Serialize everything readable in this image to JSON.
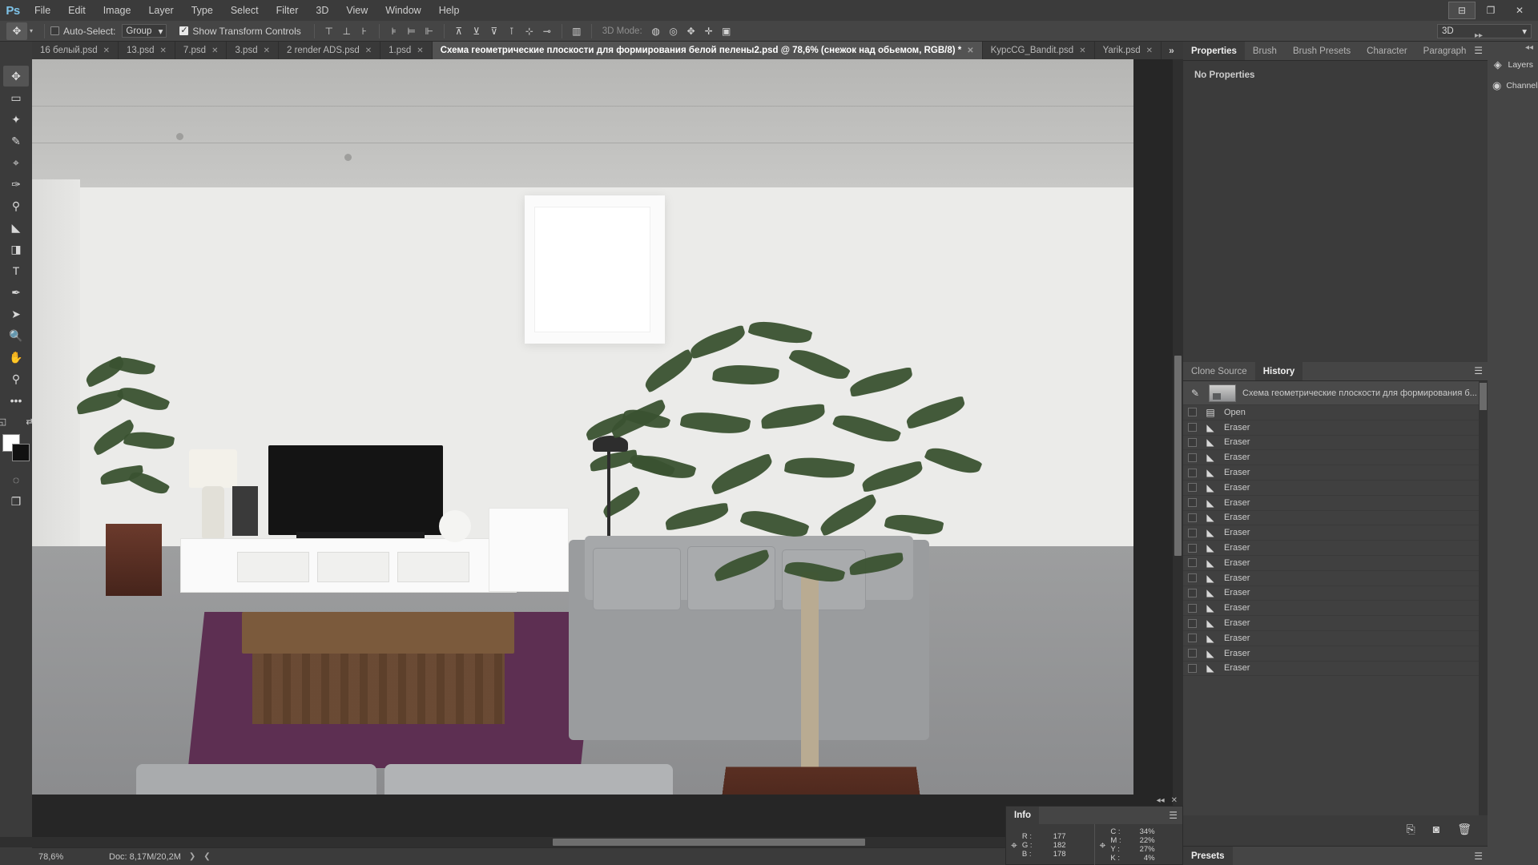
{
  "app": {
    "logo": "Ps",
    "workspace": "3D"
  },
  "menubar": {
    "items": [
      "File",
      "Edit",
      "Image",
      "Layer",
      "Type",
      "Select",
      "Filter",
      "3D",
      "View",
      "Window",
      "Help"
    ]
  },
  "window_controls": {
    "minimize": "⊟",
    "restore": "❐",
    "close": "✕"
  },
  "options_bar": {
    "tool_icon": "✥",
    "auto_select_label": "Auto-Select:",
    "auto_select_checked": false,
    "group_value": "Group",
    "show_transform_label": "Show Transform Controls",
    "show_transform_checked": true,
    "align_icons": [
      "⊤",
      "⊥",
      "⊦",
      "⊧",
      "⊨",
      "⊩"
    ],
    "distribute_icons": [
      "⊼",
      "⊻",
      "⊽",
      "⊺",
      "⊹",
      "⊸"
    ],
    "extra_icon": "▥",
    "mode_3d_label": "3D Mode:",
    "mode_3d_icons": [
      "◍",
      "◎",
      "✥",
      "✛",
      "▣"
    ]
  },
  "document_tabs": [
    {
      "label": "16 белый.psd",
      "active": false,
      "close": "✕"
    },
    {
      "label": "13.psd",
      "active": false,
      "close": "✕"
    },
    {
      "label": "7.psd",
      "active": false,
      "close": "✕"
    },
    {
      "label": "3.psd",
      "active": false,
      "close": "✕"
    },
    {
      "label": "2 render ADS.psd",
      "active": false,
      "close": "✕"
    },
    {
      "label": "1.psd",
      "active": false,
      "close": "✕"
    },
    {
      "label": "Схема геометрические плоскости для формирования белой пелены2.psd @ 78,6% (снежок над обьемом, RGB/8) *",
      "active": true,
      "close": "✕"
    },
    {
      "label": "KypcCG_Bandit.psd",
      "active": false,
      "close": "✕"
    },
    {
      "label": "Yarik.psd",
      "active": false,
      "close": "✕"
    }
  ],
  "tabs_overflow": "»",
  "toolbar": {
    "tools": [
      {
        "name": "move-tool",
        "glyph": "✥",
        "selected": true
      },
      {
        "name": "marquee-tool",
        "glyph": "▭",
        "selected": false
      },
      {
        "name": "lasso-tool",
        "glyph": "✦",
        "selected": false
      },
      {
        "name": "quick-selection-tool",
        "glyph": "✎",
        "selected": false
      },
      {
        "name": "eyedropper-tool",
        "glyph": "⌖",
        "selected": false
      },
      {
        "name": "brush-tool",
        "glyph": "✑",
        "selected": false
      },
      {
        "name": "clone-stamp-tool",
        "glyph": "⚲",
        "selected": false
      },
      {
        "name": "eraser-tool",
        "glyph": "◣",
        "selected": false
      },
      {
        "name": "gradient-tool",
        "glyph": "◨",
        "selected": false
      },
      {
        "name": "type-tool",
        "glyph": "T",
        "selected": false
      },
      {
        "name": "pen-tool",
        "glyph": "✒",
        "selected": false
      },
      {
        "name": "path-selection-tool",
        "glyph": "➤",
        "selected": false
      },
      {
        "name": "dodge-tool",
        "glyph": "🔍",
        "selected": false
      },
      {
        "name": "hand-tool",
        "glyph": "✋",
        "selected": false
      },
      {
        "name": "zoom-tool",
        "glyph": "⚲",
        "selected": false
      }
    ],
    "more_tools": "•••",
    "swap_colors": "⇄",
    "default_colors": "◱",
    "foreground_color": "#ffffff",
    "background_color": "#111111",
    "quick_mask": "◌",
    "screen_mode": "❐"
  },
  "canvas": {
    "zoom": "78,6%",
    "doc_info": "Doc: 8,17M/20,2M",
    "nav_prev": "❮",
    "nav_next": "❯"
  },
  "right_dock": {
    "top_panel": {
      "tabs": [
        "Properties",
        "Brush",
        "Brush Presets",
        "Character",
        "Paragraph"
      ],
      "active_tab": "Properties",
      "empty_message": "No Properties",
      "menu_icon": "☰",
      "collapse_icon": "▸▸"
    },
    "history_panel": {
      "tabs": [
        "Clone Source",
        "History"
      ],
      "active_tab": "History",
      "menu_icon": "☰",
      "snapshot_label": "Схема геометрические плоскости для формирования б...",
      "entries": [
        {
          "label": "Open",
          "icon": "document-icon"
        },
        {
          "label": "Eraser",
          "icon": "eraser-icon"
        },
        {
          "label": "Eraser",
          "icon": "eraser-icon"
        },
        {
          "label": "Eraser",
          "icon": "eraser-icon"
        },
        {
          "label": "Eraser",
          "icon": "eraser-icon"
        },
        {
          "label": "Eraser",
          "icon": "eraser-icon"
        },
        {
          "label": "Eraser",
          "icon": "eraser-icon"
        },
        {
          "label": "Eraser",
          "icon": "eraser-icon"
        },
        {
          "label": "Eraser",
          "icon": "eraser-icon"
        },
        {
          "label": "Eraser",
          "icon": "eraser-icon"
        },
        {
          "label": "Eraser",
          "icon": "eraser-icon"
        },
        {
          "label": "Eraser",
          "icon": "eraser-icon"
        },
        {
          "label": "Eraser",
          "icon": "eraser-icon"
        },
        {
          "label": "Eraser",
          "icon": "eraser-icon"
        },
        {
          "label": "Eraser",
          "icon": "eraser-icon"
        },
        {
          "label": "Eraser",
          "icon": "eraser-icon"
        },
        {
          "label": "Eraser",
          "icon": "eraser-icon"
        },
        {
          "label": "Eraser",
          "icon": "eraser-icon"
        }
      ],
      "footer_icons": [
        "new-document-icon",
        "new-snapshot-icon",
        "delete-icon"
      ],
      "footer_glyphs": [
        "⎘",
        "◙",
        "🗑"
      ]
    },
    "presets_panel": {
      "title": "Presets",
      "menu_icon": "☰"
    }
  },
  "info_panel": {
    "title": "Info",
    "collapse_icon": "◂◂",
    "close_icon": "✕",
    "menu_icon": "☰",
    "rgb": {
      "keys": [
        "R :",
        "G :",
        "B :"
      ],
      "values": [
        "177",
        "182",
        "178"
      ]
    },
    "cmyk": {
      "keys": [
        "C :",
        "M :",
        "Y :",
        "K :"
      ],
      "values": [
        "34%",
        "22%",
        "27%",
        "4%"
      ]
    }
  },
  "mini_dock": {
    "collapse_icon": "◂◂",
    "items": [
      {
        "label": "Layers",
        "icon": "layers-icon",
        "glyph": "◈"
      },
      {
        "label": "Channels",
        "icon": "channels-icon",
        "glyph": "◉"
      }
    ]
  }
}
